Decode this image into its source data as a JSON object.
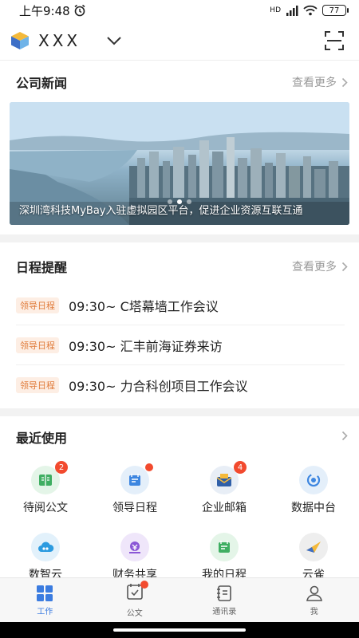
{
  "status": {
    "time": "上午9:48",
    "network": "HD",
    "battery": "77"
  },
  "header": {
    "org_name": "XXX"
  },
  "news": {
    "title": "公司新闻",
    "more": "查看更多",
    "banner_caption": "深圳湾科技MyBay入驻虚拟园区平台，促进企业资源互联互通"
  },
  "schedule": {
    "title": "日程提醒",
    "more": "查看更多",
    "items": [
      {
        "tag": "领导日程",
        "text": "09:30~ C塔幕墙工作会议"
      },
      {
        "tag": "领导日程",
        "text": "09:30~ 汇丰前海证券来访"
      },
      {
        "tag": "领导日程",
        "text": "09:30~ 力合科创项目工作会议"
      }
    ]
  },
  "recent": {
    "title": "最近使用",
    "apps": [
      {
        "label": "待阅公文",
        "badge": "2",
        "color": "#e4f5e8"
      },
      {
        "label": "领导日程",
        "badge": "",
        "color": "#e4effa"
      },
      {
        "label": "企业邮箱",
        "badge": "4",
        "color": "#e8eef6"
      },
      {
        "label": "数据中台",
        "badge": "",
        "color": "#e4effa"
      },
      {
        "label": "数智云",
        "badge": "",
        "color": "#e2f1fb"
      },
      {
        "label": "财务共享",
        "badge": "",
        "color": "#efe6fa"
      },
      {
        "label": "我的日程",
        "badge": "",
        "color": "#e4f5e8"
      },
      {
        "label": "云雀",
        "badge": "",
        "color": "#eeeeee"
      }
    ]
  },
  "tabbar": {
    "items": [
      {
        "label": "工作"
      },
      {
        "label": "公文"
      },
      {
        "label": "通讯录"
      },
      {
        "label": "我"
      }
    ]
  }
}
